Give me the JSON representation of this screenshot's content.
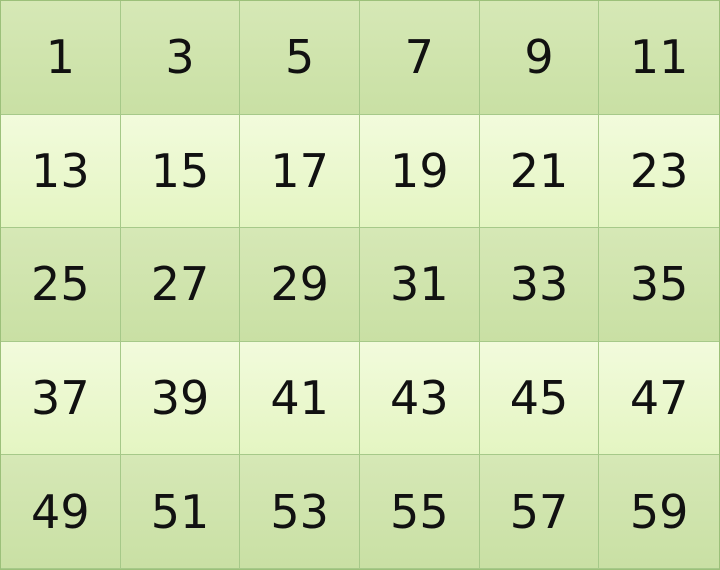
{
  "grid": {
    "rows": [
      [
        "1",
        "3",
        "5",
        "7",
        "9",
        "11"
      ],
      [
        "13",
        "15",
        "17",
        "19",
        "21",
        "23"
      ],
      [
        "25",
        "27",
        "29",
        "31",
        "33",
        "35"
      ],
      [
        "37",
        "39",
        "41",
        "43",
        "45",
        "47"
      ],
      [
        "49",
        "51",
        "53",
        "55",
        "57",
        "59"
      ]
    ]
  },
  "colors": {
    "row_dark": "#cfe4ac",
    "row_light": "#ecf8d2",
    "border": "#a6c989",
    "text": "#111111"
  }
}
